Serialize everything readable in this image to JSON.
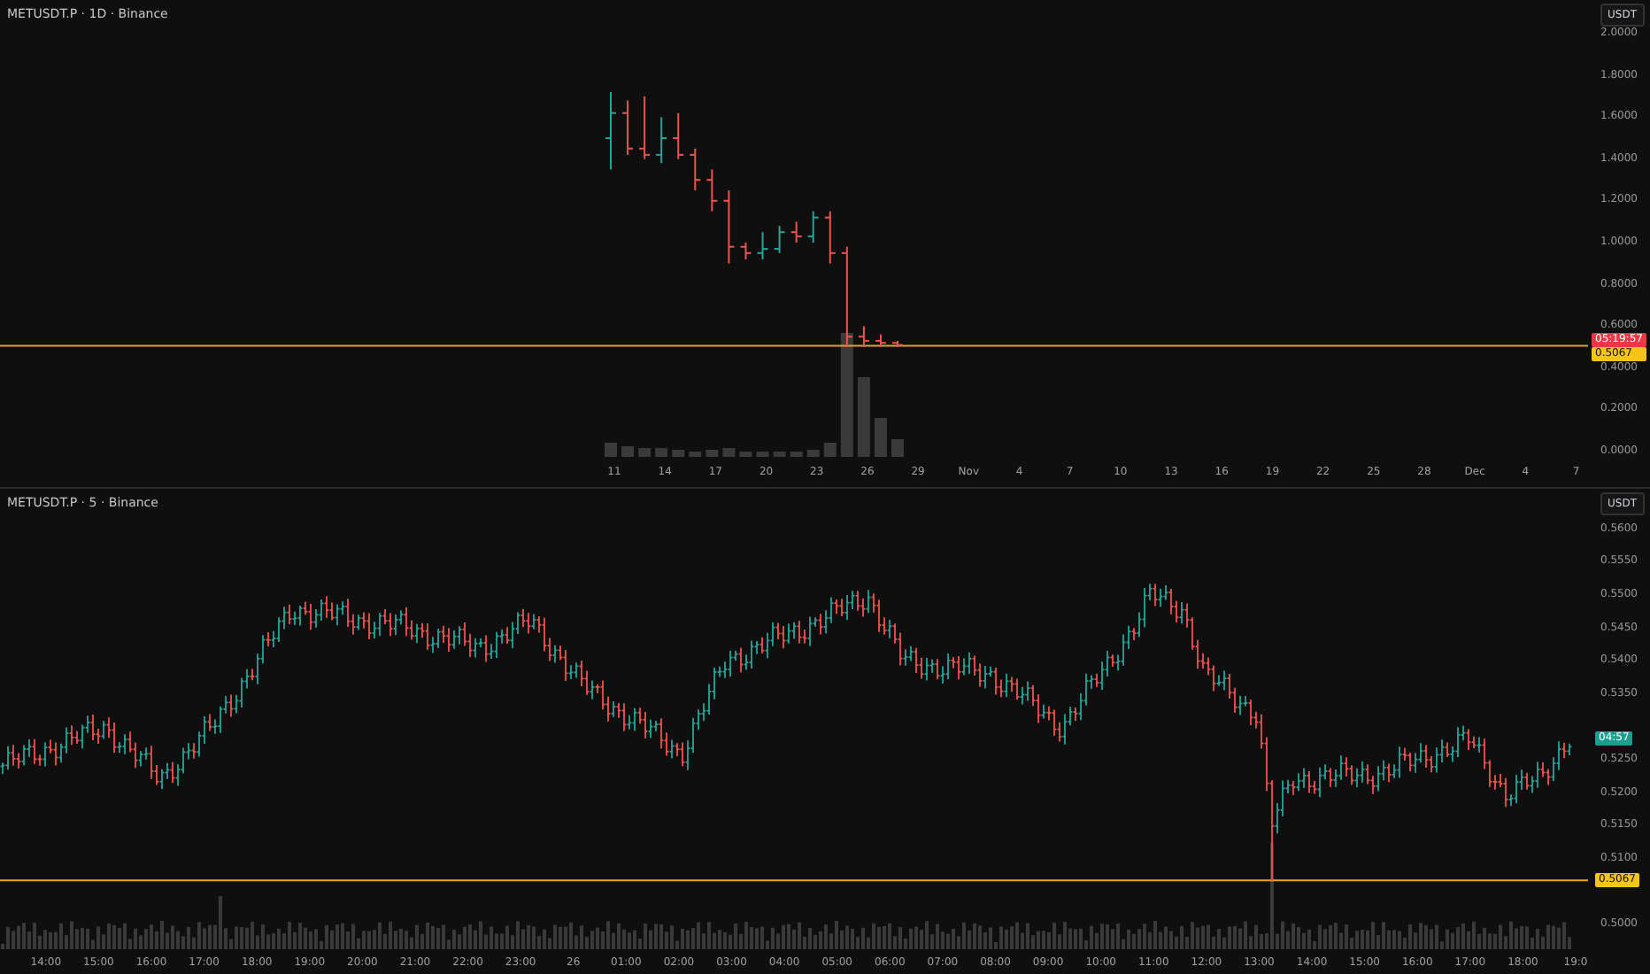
{
  "top_pane": {
    "title": "METUSDT.P · 1D · Binance",
    "currency": "USDT",
    "price_ticks": [
      "2.0000",
      "1.8000",
      "1.6000",
      "1.4000",
      "1.2000",
      "1.0000",
      "0.8000",
      "0.6000",
      "0.4000",
      "0.2000",
      "0.0000"
    ],
    "countdown_tag": "05:19:57",
    "price_tag": "0.5067",
    "time_ticks": [
      "11",
      "14",
      "17",
      "20",
      "23",
      "26",
      "29",
      "Nov",
      "4",
      "7",
      "10",
      "13",
      "16",
      "19",
      "22",
      "25",
      "28",
      "Dec",
      "4",
      "7"
    ]
  },
  "bottom_pane": {
    "title": "METUSDT.P · 5 · Binance",
    "currency": "USDT",
    "price_ticks": [
      "0.5600",
      "0.5550",
      "0.5500",
      "0.5450",
      "0.5400",
      "0.5350",
      "0.5250",
      "0.5200",
      "0.5150",
      "0.5100",
      "0.5000"
    ],
    "countdown_tag": "04:57",
    "price_tag": "0.5067",
    "time_ticks": [
      "14:00",
      "15:00",
      "16:00",
      "17:00",
      "18:00",
      "19:00",
      "20:00",
      "21:00",
      "22:00",
      "23:00",
      "26",
      "01:00",
      "02:00",
      "03:00",
      "04:00",
      "05:00",
      "06:00",
      "07:00",
      "08:00",
      "09:00",
      "10:00",
      "11:00",
      "12:00",
      "13:00",
      "14:00",
      "15:00",
      "16:00",
      "17:00",
      "18:00",
      "19:0"
    ]
  }
}
